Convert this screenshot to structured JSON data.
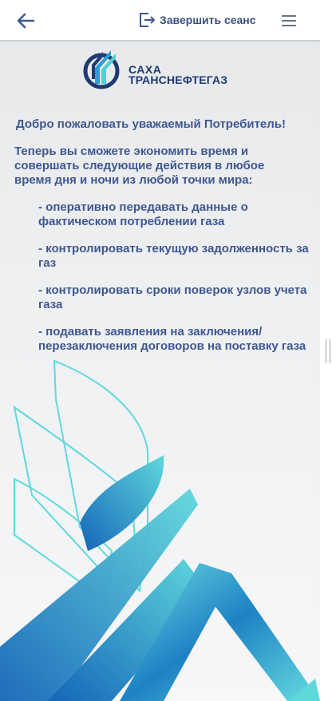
{
  "header": {
    "back_icon": "arrow-left-icon",
    "logout_icon": "logout-icon",
    "logout_label": "Завершить сеанс",
    "menu_icon": "hamburger-menu-icon"
  },
  "logo": {
    "line1": "САХА",
    "line2": "ТРАНСНЕФТЕГАЗ"
  },
  "main": {
    "welcome": "Добро пожаловать уважаемый Потребитель!",
    "intro": "Теперь вы сможете экономить время и совершать следующие действия в любое время дня и ночи из любой точки мира:",
    "features": [
      "- оперативно передавать данные о фактическом потреблении газа",
      "- контролировать текущую задолженность за газ",
      "- контролировать сроки поверок узлов учета газа",
      "- подавать заявления на заключения/ перезаключения договоров на поставку газа"
    ]
  },
  "colors": {
    "text_primary": "#3f5791",
    "brand_dark": "#1e3a70",
    "accent_teal": "#4fd0d6",
    "accent_blue": "#1a7fc1"
  }
}
